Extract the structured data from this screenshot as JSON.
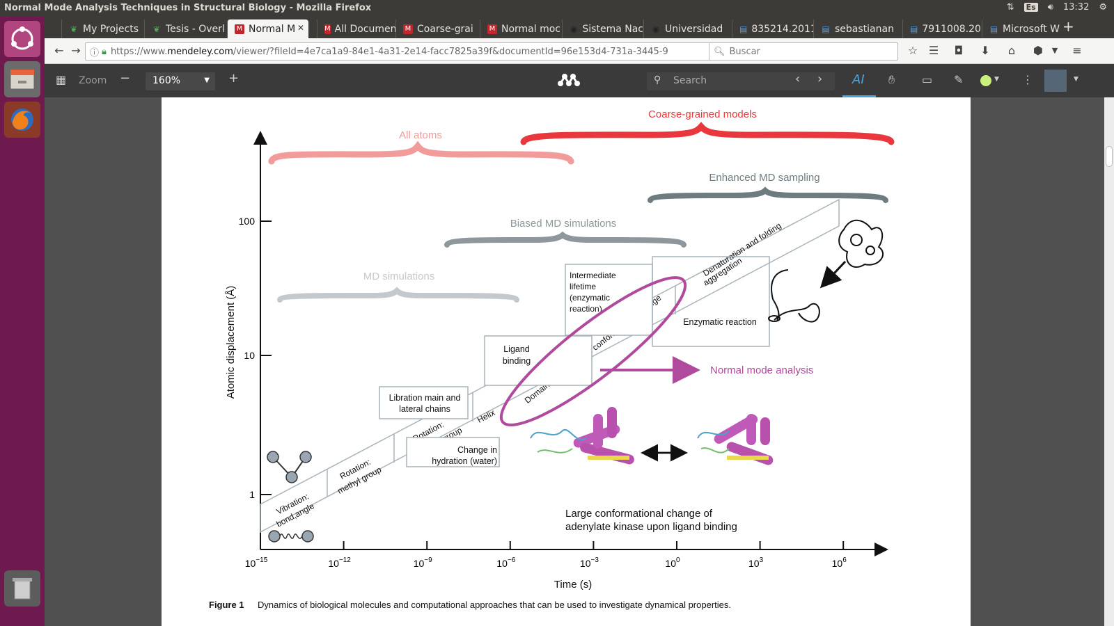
{
  "window": {
    "title": "Normal Mode Analysis Techniques in Structural Biology - Mozilla Firefox",
    "keyboard_layout": "Es",
    "clock": "13:32"
  },
  "tabs": [
    {
      "label": "My Projects",
      "icon": "overleaf-icon"
    },
    {
      "label": "Tesis - Overl",
      "icon": "overleaf-icon"
    },
    {
      "label": "Normal M",
      "icon": "mendeley-icon",
      "active": true
    },
    {
      "label": "All Documen",
      "icon": "mendeley-icon"
    },
    {
      "label": "Coarse-grai",
      "icon": "mendeley-icon"
    },
    {
      "label": "Normal moc",
      "icon": "mendeley-icon"
    },
    {
      "label": "Sistema Nac",
      "icon": "globe-icon"
    },
    {
      "label": "Universidad",
      "icon": "globe-icon"
    },
    {
      "label": "835214.2011",
      "icon": "document-icon"
    },
    {
      "label": "sebastianan",
      "icon": "document-icon"
    },
    {
      "label": "7911008.201",
      "icon": "document-icon"
    },
    {
      "label": "Microsoft W",
      "icon": "document-icon"
    }
  ],
  "nav": {
    "url_prefix": "https://www.",
    "url_domain": "mendeley.com",
    "url_rest": "/viewer/?fileId=4e7ca1a9-84e1-4a31-2e14-facc7825a39f&documentId=96e153d4-731a-3445-9",
    "search_placeholder": "Buscar"
  },
  "viewer_toolbar": {
    "zoom_label": "Zoom",
    "zoom_value": "160%",
    "search_placeholder": "Search",
    "accent": "#4aa3df"
  },
  "figure": {
    "brackets": {
      "all_atoms": "All atoms",
      "coarse_grained": "Coarse-grained models",
      "enhanced_md": "Enhanced MD sampling",
      "biased_md": "Biased MD simulations",
      "md_sim": "MD simulations"
    },
    "colors": {
      "all_atoms": "#f29b9b",
      "coarse_grained": "#e8383d",
      "enhanced_md": "#6e7b80",
      "biased_md": "#8e979b",
      "md_sim": "#c3c9cc",
      "normal_mode": "#b04a9c"
    },
    "y_axis_label": "Atomic displacement (Å)",
    "y_ticks": [
      "100",
      "10",
      "1"
    ],
    "x_axis_label": "Time (s)",
    "x_ticks": [
      {
        "base": "10",
        "exp": "−15"
      },
      {
        "base": "10",
        "exp": "−12"
      },
      {
        "base": "10",
        "exp": "−9"
      },
      {
        "base": "10",
        "exp": "−6"
      },
      {
        "base": "10",
        "exp": "−3"
      },
      {
        "base": "10",
        "exp": "0"
      },
      {
        "base": "10",
        "exp": "3"
      },
      {
        "base": "10",
        "exp": "6"
      }
    ],
    "band": {
      "vibration_1": "Vibration:",
      "vibration_2": "bond,angle",
      "rot_methyl_1": "Rotation:",
      "rot_methyl_2": "methyl group",
      "rot_methylene_1": "Rotation:",
      "rot_methylene_2": "methylene group",
      "helix": "Helix",
      "domain": "Domain motions, large conformational change",
      "denat_1": "Denaturation and folding",
      "denat_2": "aggregation"
    },
    "boxes": {
      "libration_1": "Libration main and",
      "libration_2": "lateral chains",
      "hydration_1": "Change in",
      "hydration_2": "hydration (water)",
      "ligand_1": "Ligand",
      "ligand_2": "binding",
      "intermediate_1": "Intermediate",
      "intermediate_2": "lifetime",
      "intermediate_3": "(enzymatic",
      "intermediate_4": "reaction)",
      "enzymatic": "Enzymatic reaction"
    },
    "normal_mode": "Normal mode analysis",
    "adk_caption_1": "Large conformational change of",
    "adk_caption_2": "adenylate kinase upon ligand binding",
    "caption_label": "Figure 1",
    "caption_text": "Dynamics of biological molecules and computational approaches that can be used to investigate dynamical properties."
  }
}
